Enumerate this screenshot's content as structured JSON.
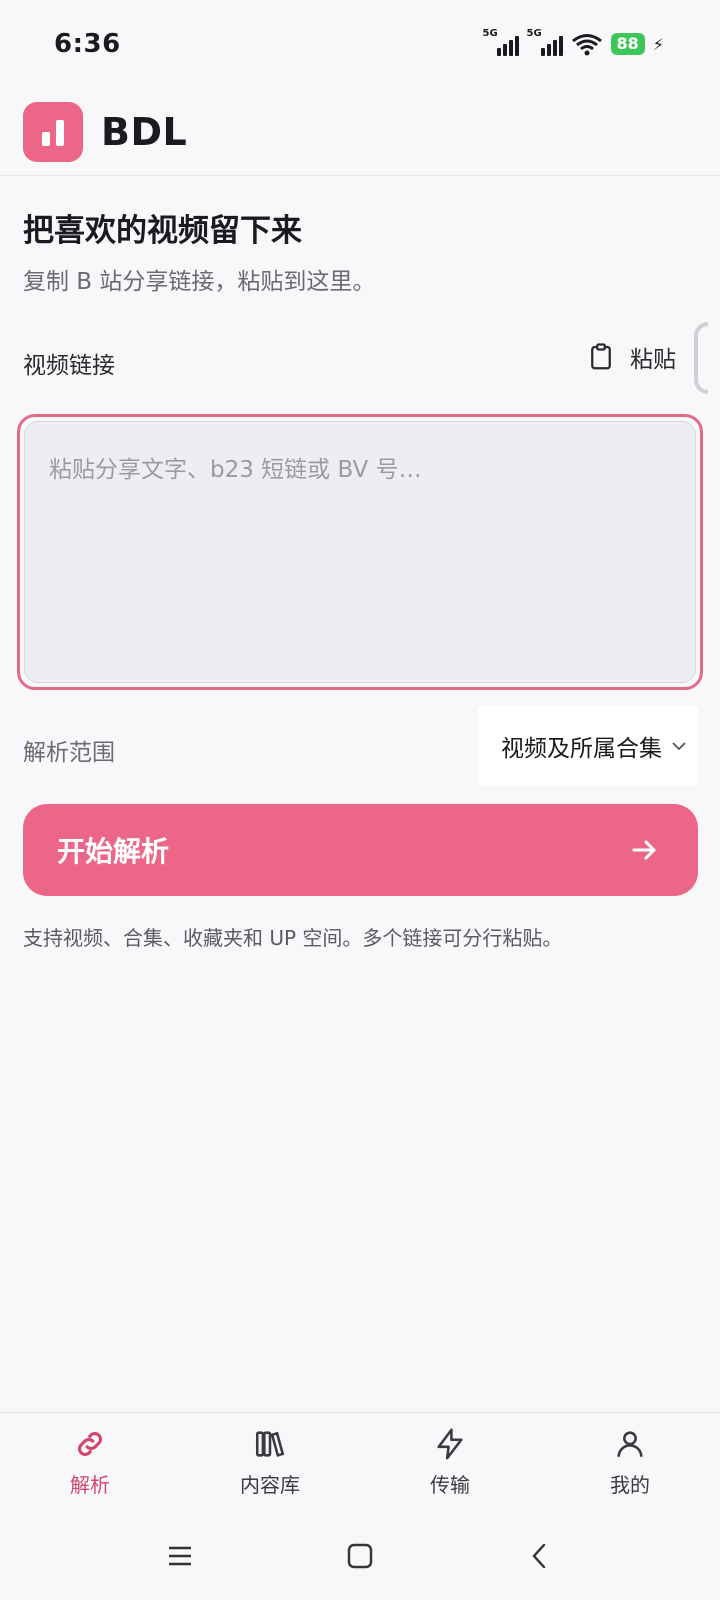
{
  "status_bar": {
    "time": "6:36",
    "signal_1": "5G",
    "signal_2": "5G",
    "battery": "88"
  },
  "app": {
    "title": "BDL",
    "accent_color": "#ec6787"
  },
  "main": {
    "headline": "把喜欢的视频留下来",
    "subline": "复制 B 站分享链接，粘贴到这里。",
    "field_label": "视频链接",
    "paste_label": "粘贴",
    "input_placeholder": "粘贴分享文字、b23 短链或 BV 号…",
    "input_value": "",
    "scope_label": "解析范围",
    "scope_selected": "视频及所属合集",
    "start_label": "开始解析",
    "hint": "支持视频、合集、收藏夹和 UP 空间。多个链接可分行粘贴。"
  },
  "bottom_nav": {
    "items": [
      {
        "label": "解析",
        "icon": "link-icon",
        "active": true
      },
      {
        "label": "内容库",
        "icon": "library-icon",
        "active": false
      },
      {
        "label": "传输",
        "icon": "bolt-icon",
        "active": false
      },
      {
        "label": "我的",
        "icon": "person-icon",
        "active": false
      }
    ]
  },
  "system_nav": {
    "icons": [
      "menu-icon",
      "home-icon",
      "back-icon"
    ]
  }
}
